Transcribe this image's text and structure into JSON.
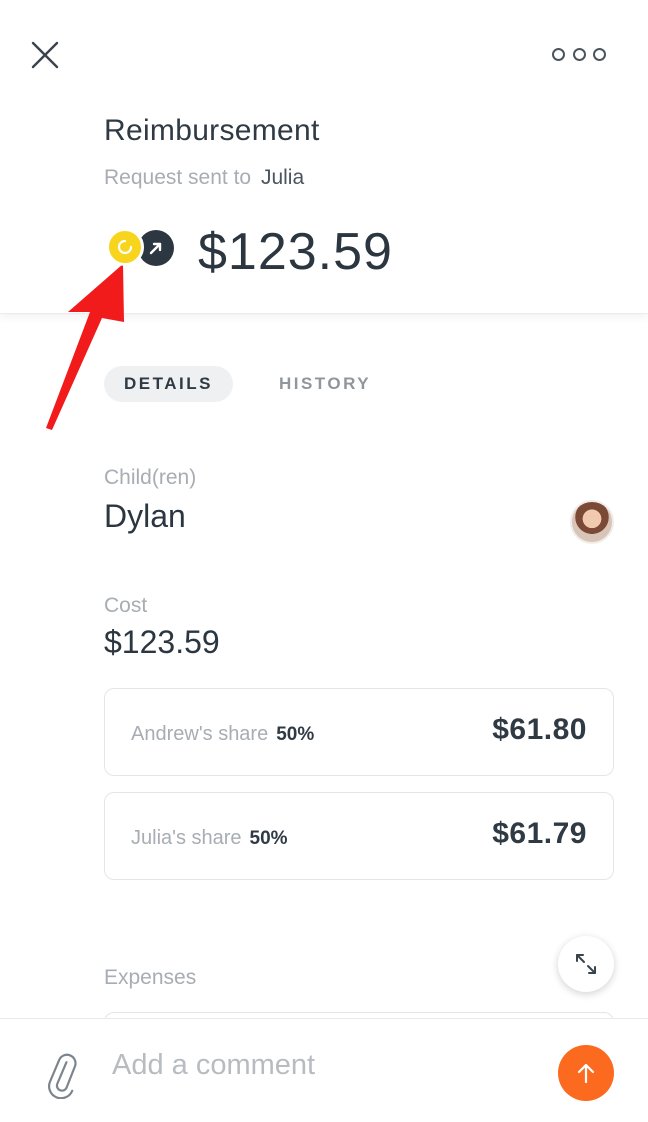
{
  "header": {
    "title": "Reimbursement",
    "subtitle_prefix": "Request sent to",
    "recipient": "Julia",
    "amount": "$123.59",
    "close_icon": "close-icon",
    "more_icon": "more-options-icon"
  },
  "status_icons": {
    "pending": "pending-status-icon",
    "sent": "sent-arrow-icon"
  },
  "tabs": [
    {
      "label": "DETAILS",
      "active": true
    },
    {
      "label": "HISTORY",
      "active": false
    }
  ],
  "details": {
    "children_label": "Child(ren)",
    "children_value": "Dylan",
    "cost_label": "Cost",
    "cost_value": "$123.59"
  },
  "shares": [
    {
      "label": "Andrew's share",
      "percent": "50%",
      "amount": "$61.80"
    },
    {
      "label": "Julia's share",
      "percent": "50%",
      "amount": "$61.79"
    }
  ],
  "expenses_label": "Expenses",
  "footer": {
    "comment_placeholder": "Add a comment",
    "attach_icon": "paperclip-icon",
    "send_icon": "send-arrow-icon"
  },
  "colors": {
    "pending": "#f8d51c",
    "sent": "#2d3741",
    "send_button": "#fb6a1f",
    "annotation_arrow": "#f21b1b"
  }
}
